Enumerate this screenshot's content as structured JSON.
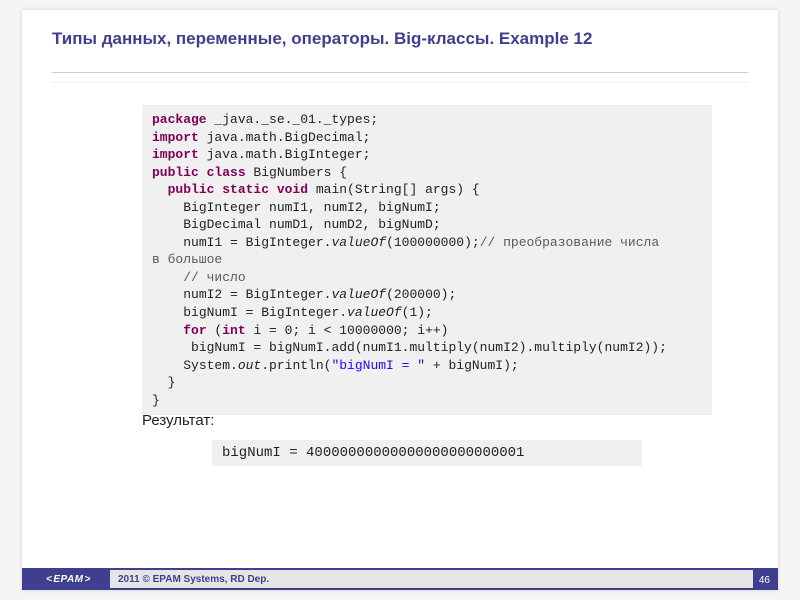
{
  "title": "Типы данных, переменные, операторы. Big-классы. Example 12",
  "code": {
    "line1_kw": "package",
    "line1_rest": " _java._se._01._types;",
    "line2_kw": "import",
    "line2_rest": " java.math.BigDecimal;",
    "line3_kw": "import",
    "line3_rest": " java.math.BigInteger;",
    "line4_kw": "public class",
    "line4_rest": " BigNumbers {",
    "line5_pad": "  ",
    "line5_kw": "public static void",
    "line5_rest": " main(String[] args) {",
    "line6": "    BigInteger numI1, numI2, bigNumI;",
    "line7": "    BigDecimal numD1, numD2, bigNumD;",
    "line8a": "    numI1 = BigInteger.",
    "line8b": "valueOf",
    "line8c": "(100000000);",
    "line8cmt": "// преобразование числа",
    "line9a": "в большое",
    "line10pad": "    ",
    "line10cmt": "// число",
    "line11a": "    numI2 = BigInteger.",
    "line11b": "valueOf",
    "line11c": "(200000);",
    "line12a": "    bigNumI = BigInteger.",
    "line12b": "valueOf",
    "line12c": "(1);",
    "line13pad": "    ",
    "line13kw1": "for",
    "line13a": " (",
    "line13kw2": "int",
    "line13b": " i = 0; i < 10000000; i++)",
    "line14": "     bigNumI = bigNumI.add(numI1.multiply(numI2).multiply(numI2));",
    "line15a": "    System.",
    "line15b": "out",
    "line15c": ".println(",
    "line15str": "\"bigNumI = \"",
    "line15d": " + bigNumI);",
    "line16": "  }",
    "line17": "}"
  },
  "result_label": "Результат:",
  "result_value": "bigNumI = 40000000000000000000000001",
  "footer_text": "2011 © EPAM Systems, RD Dep.",
  "logo_text": "EPAM",
  "page_number": "46"
}
